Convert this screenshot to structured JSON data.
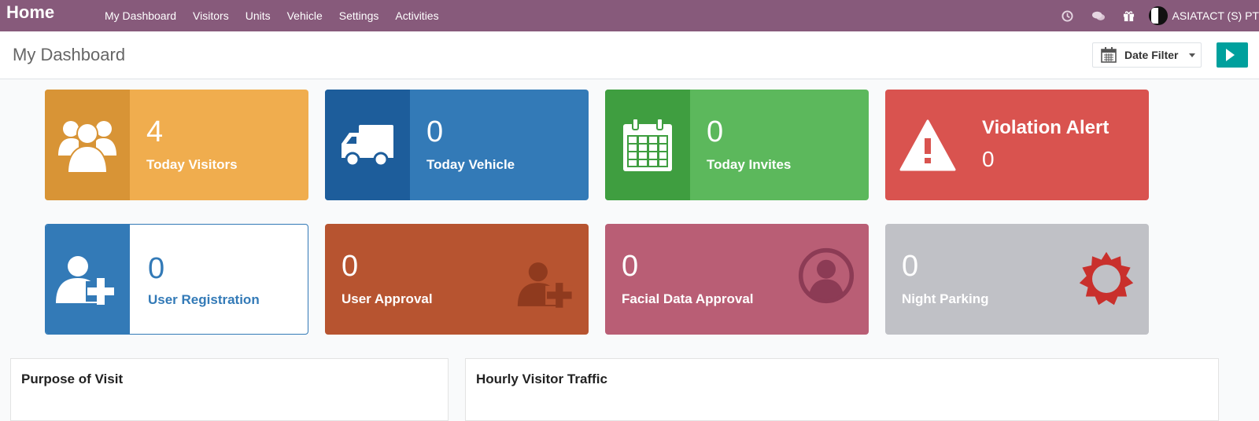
{
  "nav": {
    "brand": "Home",
    "menu": [
      "My Dashboard",
      "Visitors",
      "Units",
      "Vehicle",
      "Settings",
      "Activities"
    ],
    "company": "ASIATACT (S) PT"
  },
  "control_panel": {
    "title": "My Dashboard",
    "date_filter_label": "Date Filter"
  },
  "cards": {
    "visitors": {
      "value": "4",
      "label": "Today Visitors"
    },
    "vehicle": {
      "value": "0",
      "label": "Today Vehicle"
    },
    "invites": {
      "value": "0",
      "label": "Today Invites"
    },
    "violation": {
      "value": "0",
      "label": "Violation Alert"
    },
    "user_registration": {
      "value": "0",
      "label": "User Registration"
    },
    "user_approval": {
      "value": "0",
      "label": "User Approval"
    },
    "facial_approval": {
      "value": "0",
      "label": "Facial Data Approval"
    },
    "night_parking": {
      "value": "0",
      "label": "Night Parking"
    }
  },
  "panels": {
    "purpose": "Purpose of Visit",
    "hourly": "Hourly Visitor Traffic"
  },
  "colors": {
    "nav": "#875a7b",
    "visitors": "#f0ad4e",
    "vehicle": "#337ab7",
    "invites": "#5cb85c",
    "violation": "#d9534f",
    "approval": "#b75430",
    "facial": "#b95e75",
    "night": "#c0c1c6",
    "accent_button": "#00a09d"
  },
  "icons": [
    "clock-icon",
    "chat-icon",
    "gift-icon",
    "users-icon",
    "truck-icon",
    "calendar-icon",
    "warning-icon",
    "user-plus-icon",
    "user-circle-icon",
    "sun-icon"
  ]
}
